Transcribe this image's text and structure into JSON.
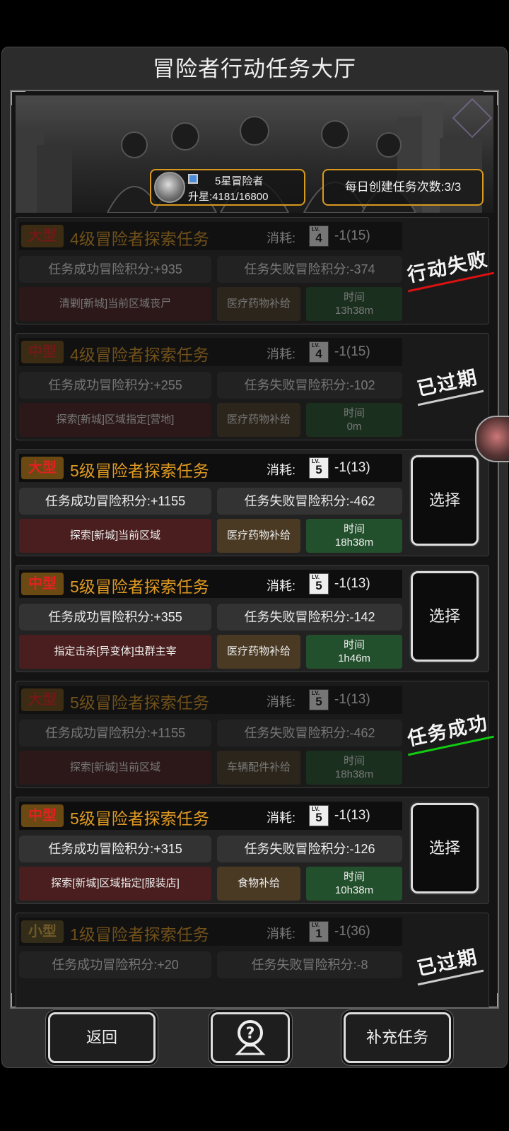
{
  "title": "冒险者行动任务大厅",
  "rank": {
    "title": "5星冒险者",
    "progress": "升星:4181/16800"
  },
  "daily_quota": "每日创建任务次数:3/3",
  "cost_label": "消耗:",
  "time_label": "时间",
  "select_label": "选择",
  "missions": [
    {
      "size": "大型",
      "title": "4级冒险者探索任务",
      "lv": "4",
      "cost": "-1(15)",
      "success": "任务成功冒险积分:+935",
      "fail": "任务失败冒险积分:-374",
      "task": "清剿[新城]当前区域丧尸",
      "supply": "医疗药物补给",
      "time": "13h38m",
      "status": "行动失败",
      "dim": true
    },
    {
      "size": "中型",
      "title": "4级冒险者探索任务",
      "lv": "4",
      "cost": "-1(15)",
      "success": "任务成功冒险积分:+255",
      "fail": "任务失败冒险积分:-102",
      "task": "探索[新城]区域指定[营地]",
      "supply": "医疗药物补给",
      "time": "0m",
      "status": "已过期",
      "dim": true
    },
    {
      "size": "大型",
      "title": "5级冒险者探索任务",
      "lv": "5",
      "cost": "-1(13)",
      "success": "任务成功冒险积分:+1155",
      "fail": "任务失败冒险积分:-462",
      "task": "探索[新城]当前区域",
      "supply": "医疗药物补给",
      "time": "18h38m",
      "status": "",
      "dim": false
    },
    {
      "size": "中型",
      "title": "5级冒险者探索任务",
      "lv": "5",
      "cost": "-1(13)",
      "success": "任务成功冒险积分:+355",
      "fail": "任务失败冒险积分:-142",
      "task": "指定击杀[异变体]虫群主宰",
      "supply": "医疗药物补给",
      "time": "1h46m",
      "status": "",
      "dim": false
    },
    {
      "size": "大型",
      "title": "5级冒险者探索任务",
      "lv": "5",
      "cost": "-1(13)",
      "success": "任务成功冒险积分:+1155",
      "fail": "任务失败冒险积分:-462",
      "task": "探索[新城]当前区域",
      "supply": "车辆配件补给",
      "time": "18h38m",
      "status": "任务成功",
      "dim": true
    },
    {
      "size": "中型",
      "title": "5级冒险者探索任务",
      "lv": "5",
      "cost": "-1(13)",
      "success": "任务成功冒险积分:+315",
      "fail": "任务失败冒险积分:-126",
      "task": "探索[新城]区域指定[服装店]",
      "supply": "食物补给",
      "time": "10h38m",
      "status": "",
      "dim": false
    },
    {
      "size": "小型",
      "title": "1级冒险者探索任务",
      "lv": "1",
      "cost": "-1(36)",
      "success": "任务成功冒险积分:+20",
      "fail": "任务失败冒险积分:-8",
      "task": "",
      "supply": "",
      "time": "",
      "status": "已过期",
      "dim": true
    }
  ],
  "buttons": {
    "back": "返回",
    "refill": "补充任务"
  },
  "icons": {
    "help": "help-question-icon"
  },
  "colors": {
    "title_orange": "#e09a22",
    "tag_red": "#e42020",
    "gold_border": "#d79a1f"
  }
}
